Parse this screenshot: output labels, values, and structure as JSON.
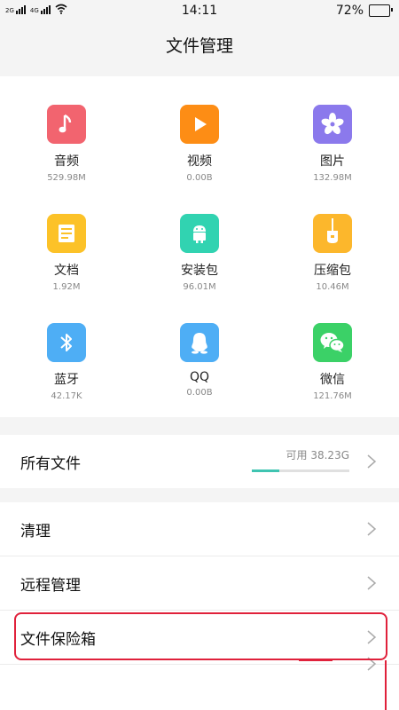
{
  "status_bar": {
    "sim1": "2G",
    "sim2": "4G",
    "time": "14:11",
    "battery_percent": "72%",
    "battery_level": 0.72
  },
  "header": {
    "title": "文件管理"
  },
  "categories": [
    {
      "label": "音频",
      "size": "529.98M",
      "icon": "music-note-icon",
      "color": "#f2646f"
    },
    {
      "label": "视频",
      "size": "0.00B",
      "icon": "play-icon",
      "color": "#fd8d15"
    },
    {
      "label": "图片",
      "size": "132.98M",
      "icon": "flower-icon",
      "color": "#8b79ec"
    },
    {
      "label": "文档",
      "size": "1.92M",
      "icon": "document-icon",
      "color": "#fcc228"
    },
    {
      "label": "安装包",
      "size": "96.01M",
      "icon": "android-icon",
      "color": "#31d3b1"
    },
    {
      "label": "压缩包",
      "size": "10.46M",
      "icon": "zip-icon",
      "color": "#fcb72c"
    },
    {
      "label": "蓝牙",
      "size": "42.17K",
      "icon": "bluetooth-icon",
      "color": "#4eaef5"
    },
    {
      "label": "QQ",
      "size": "0.00B",
      "icon": "qq-icon",
      "color": "#4eaef5"
    },
    {
      "label": "微信",
      "size": "121.76M",
      "icon": "wechat-icon",
      "color": "#3bd167"
    }
  ],
  "all_files": {
    "label": "所有文件",
    "available": "可用 38.23G",
    "used_fraction": 0.28
  },
  "menu": [
    {
      "label": "清理"
    },
    {
      "label": "远程管理"
    },
    {
      "label": "文件保险箱"
    }
  ],
  "accent_color": "#3fc4b1",
  "highlight_color": "#e0213b"
}
